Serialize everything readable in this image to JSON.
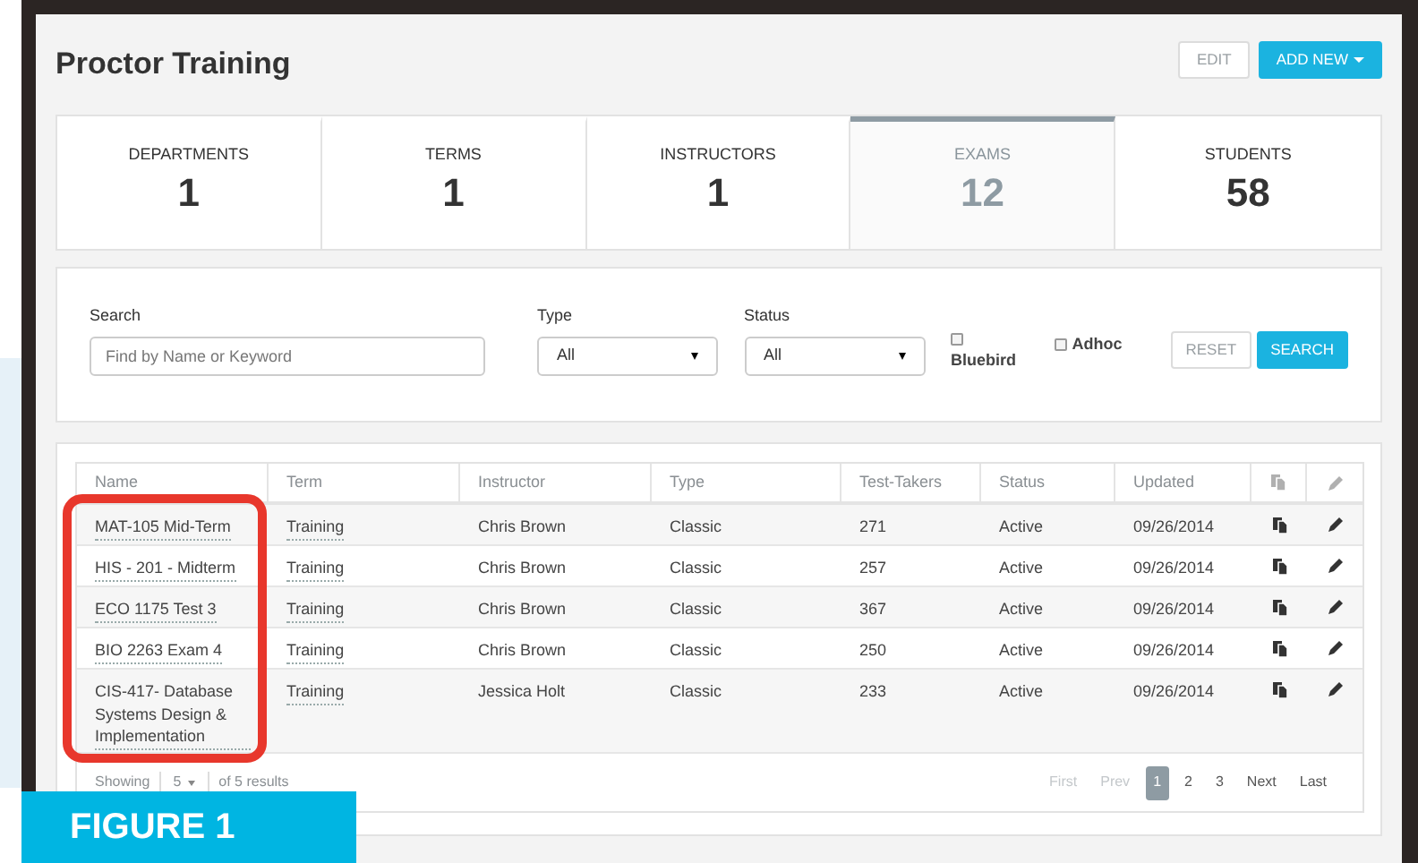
{
  "page": {
    "title": "Proctor Training",
    "buttons": [
      {
        "label": "EDIT",
        "kind": "secondary",
        "caret": false
      },
      {
        "label": "ADD NEW",
        "kind": "primary",
        "caret": true
      }
    ]
  },
  "stats": [
    {
      "label": "DEPARTMENTS",
      "value": "1",
      "selected": false
    },
    {
      "label": "TERMS",
      "value": "1",
      "selected": false
    },
    {
      "label": "INSTRUCTORS",
      "value": "1",
      "selected": false
    },
    {
      "label": "EXAMS",
      "value": "12",
      "selected": true
    },
    {
      "label": "STUDENTS",
      "value": "58",
      "selected": false
    }
  ],
  "filters": {
    "search": {
      "label": "Search",
      "placeholder": "Find by Name or Keyword"
    },
    "selects": [
      {
        "label": "Type",
        "value": "All"
      },
      {
        "label": "Status",
        "value": "All"
      }
    ],
    "checkboxes": [
      {
        "label": "Bluebird",
        "checked": false,
        "kind": "stacked"
      },
      {
        "label": "Adhoc",
        "checked": false,
        "kind": "inline"
      }
    ],
    "buttons": [
      {
        "label": "RESET",
        "kind": "secondary"
      },
      {
        "label": "SEARCH",
        "kind": "primary"
      }
    ]
  },
  "table": {
    "columns": [
      "Name",
      "Term",
      "Instructor",
      "Type",
      "Test-Takers",
      "Status",
      "Updated"
    ],
    "rows": [
      {
        "name": "MAT-105 Mid-Term",
        "term": "Training",
        "instructor": "Chris Brown",
        "type": "Classic",
        "test_takers": "271",
        "status": "Active",
        "updated": "09/26/2014"
      },
      {
        "name": "HIS - 201 - Midterm",
        "term": "Training",
        "instructor": "Chris Brown",
        "type": "Classic",
        "test_takers": "257",
        "status": "Active",
        "updated": "09/26/2014"
      },
      {
        "name": "ECO 1175 Test 3",
        "term": "Training",
        "instructor": "Chris Brown",
        "type": "Classic",
        "test_takers": "367",
        "status": "Active",
        "updated": "09/26/2014"
      },
      {
        "name": "BIO 2263 Exam 4",
        "term": "Training",
        "instructor": "Chris Brown",
        "type": "Classic",
        "test_takers": "250",
        "status": "Active",
        "updated": "09/26/2014"
      },
      {
        "name": "CIS-417- Database Systems Design & Implementation",
        "term": "Training",
        "instructor": "Jessica Holt",
        "type": "Classic",
        "test_takers": "233",
        "status": "Active",
        "updated": "09/26/2014"
      }
    ],
    "footer": {
      "showing": "Showing",
      "page_size": "5",
      "results": "of 5 results"
    },
    "pagination": [
      {
        "label": "First",
        "disabled": true,
        "selected": false
      },
      {
        "label": "Prev",
        "disabled": true,
        "selected": false
      },
      {
        "label": "1",
        "disabled": false,
        "selected": true
      },
      {
        "label": "2",
        "disabled": false,
        "selected": false
      },
      {
        "label": "3",
        "disabled": false,
        "selected": false
      },
      {
        "label": "Next",
        "disabled": false,
        "selected": false
      },
      {
        "label": "Last",
        "disabled": false,
        "selected": false
      }
    ]
  },
  "annotation": {
    "label": "FIGURE 1"
  }
}
